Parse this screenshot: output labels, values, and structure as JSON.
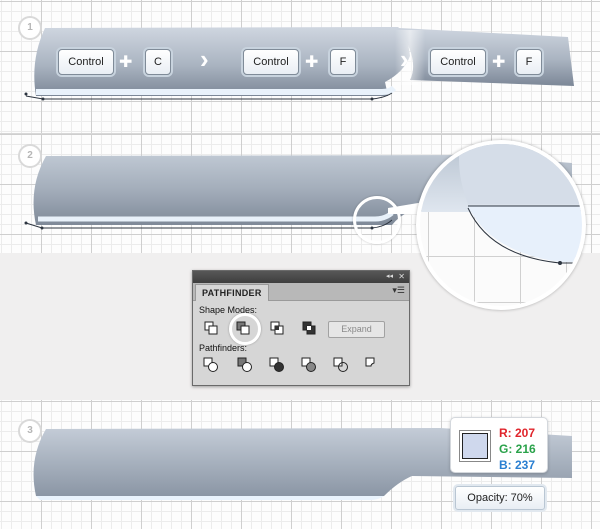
{
  "steps": [
    "1",
    "2",
    "3"
  ],
  "shortcuts": {
    "key1": "Control",
    "key2": "C",
    "key3": "Control",
    "key4": "F",
    "key5": "Control",
    "key6": "F",
    "plus": "✚",
    "arrow": "›"
  },
  "pathfinder": {
    "tab": "PATHFINDER",
    "collapse_glyph": "◂◂",
    "close_glyph": "✕",
    "menu_glyph": "▾☰",
    "shape_modes_label": "Shape Modes:",
    "pathfinders_label": "Pathfinders:",
    "expand_label": "Expand",
    "shape_mode_icons": [
      "unite-icon",
      "minus-front-icon",
      "intersect-icon",
      "exclude-icon"
    ],
    "pathfinder_icons": [
      "divide-icon",
      "trim-icon",
      "merge-icon",
      "crop-icon",
      "outline-icon",
      "minus-back-icon"
    ]
  },
  "color": {
    "r_label": "R: 207",
    "g_label": "G: 216",
    "b_label": "B: 237",
    "fill": "#CFD8ED",
    "r_color": "#e0242b",
    "g_color": "#2aa24a",
    "b_color": "#2a7fd1"
  },
  "opacity_label": "Opacity: 70%"
}
